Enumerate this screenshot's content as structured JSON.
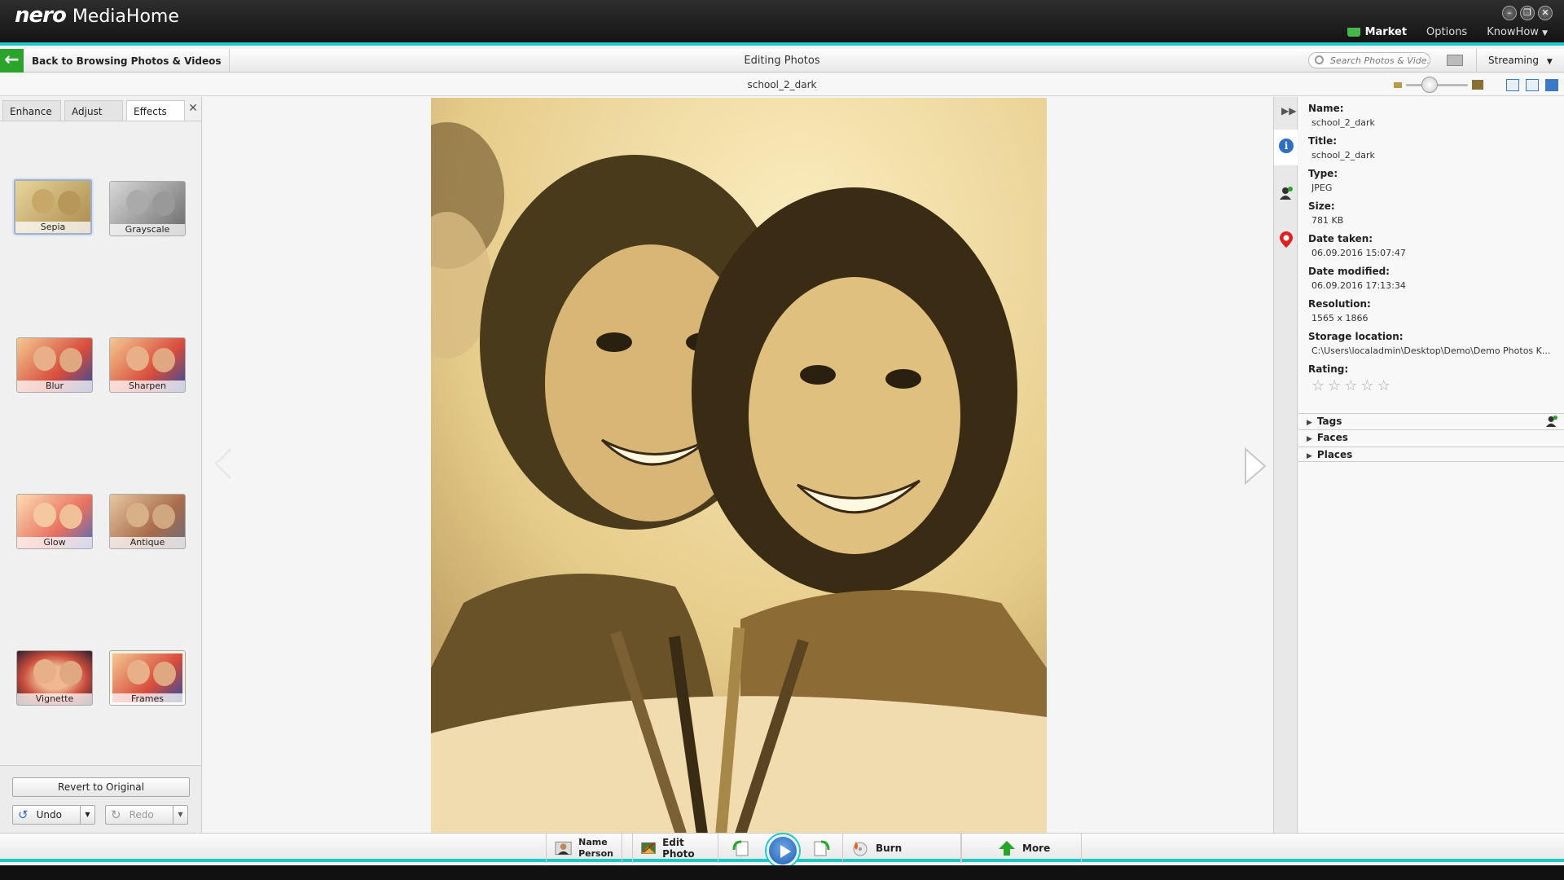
{
  "app": {
    "brand": "nero",
    "name": "MediaHome",
    "accent": "#1ec8c8"
  },
  "topmenu": {
    "market": "Market",
    "options": "Options",
    "knowhow": "KnowHow"
  },
  "navbar": {
    "back_label": "Back to Browsing Photos & Videos",
    "title": "Editing Photos",
    "search_placeholder": "Search Photos & Vide...",
    "streaming": "Streaming"
  },
  "subbar": {
    "filename": "school_2_dark"
  },
  "leftpanel": {
    "tabs": [
      {
        "label": "Enhance"
      },
      {
        "label": "Adjust"
      },
      {
        "label": "Effects"
      }
    ],
    "active_tab": "Effects",
    "effects": [
      {
        "label": "Sepia",
        "selected": true
      },
      {
        "label": "Grayscale"
      },
      {
        "label": "Blur"
      },
      {
        "label": "Sharpen"
      },
      {
        "label": "Glow"
      },
      {
        "label": "Antique"
      },
      {
        "label": "Vignette"
      },
      {
        "label": "Frames"
      }
    ],
    "revert_label": "Revert to Original",
    "undo_label": "Undo",
    "redo_label": "Redo"
  },
  "info": {
    "name_label": "Name:",
    "name_value": "school_2_dark",
    "title_label": "Title:",
    "title_value": "school_2_dark",
    "type_label": "Type:",
    "type_value": "JPEG",
    "size_label": "Size:",
    "size_value": "781 KB",
    "date_taken_label": "Date taken:",
    "date_taken_value": "06.09.2016 15:07:47",
    "date_modified_label": "Date modified:",
    "date_modified_value": "06.09.2016 17:13:34",
    "resolution_label": "Resolution:",
    "resolution_value": "1565 x 1866",
    "storage_label": "Storage location:",
    "storage_value": "C:\\Users\\localadmin\\Desktop\\Demo\\Demo Photos K...",
    "rating_label": "Rating:",
    "rating": 0,
    "sections": [
      {
        "label": "Tags"
      },
      {
        "label": "Faces"
      },
      {
        "label": "Places"
      }
    ]
  },
  "toolbar": {
    "name_person_1": "Name",
    "name_person_2": "Person",
    "edit_photo": "Edit Photo",
    "burn": "Burn",
    "more": "More"
  }
}
